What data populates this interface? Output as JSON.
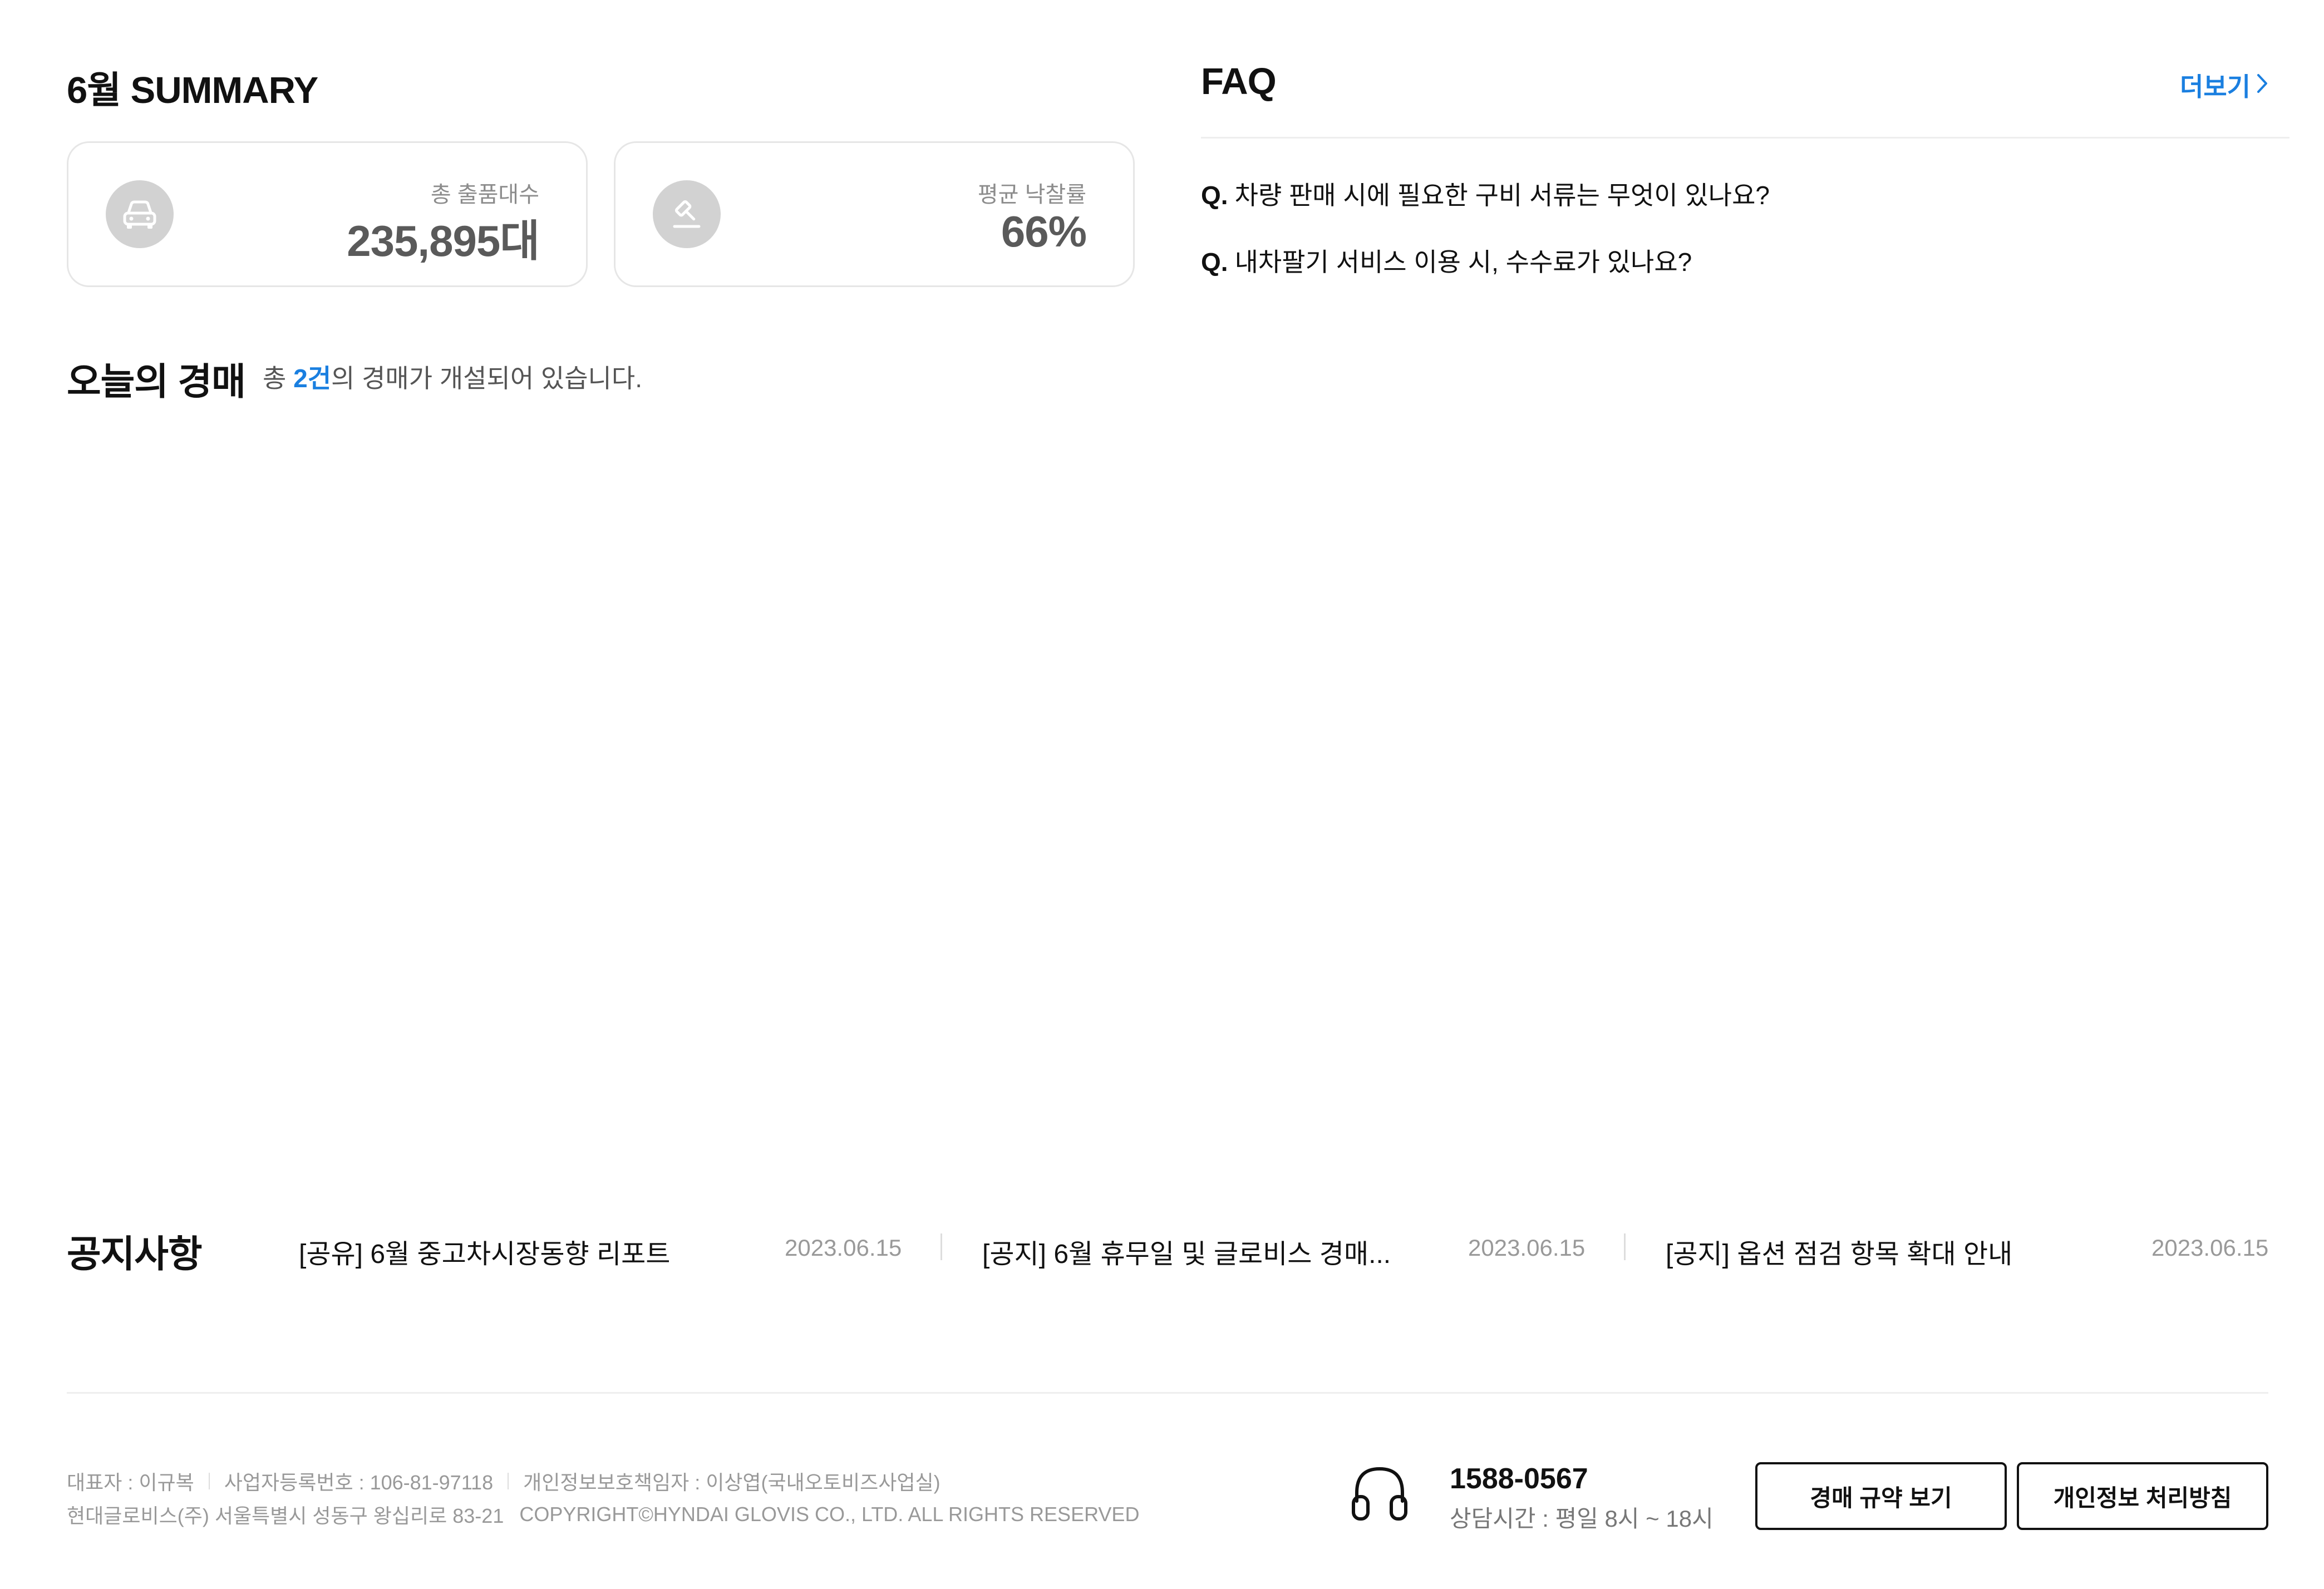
{
  "summary": {
    "title": "6월 SUMMARY",
    "cards": [
      {
        "icon": "car-icon",
        "label": "총 출품대수",
        "value": "235,895대"
      },
      {
        "icon": "auction-hammer-icon",
        "label": "평균 낙찰률",
        "value": "66%"
      }
    ]
  },
  "faq": {
    "title": "FAQ",
    "more_label": "더보기",
    "items": [
      {
        "q": "Q.",
        "text": "차량 판매 시에 필요한 구비 서류는 무엇이 있나요?"
      },
      {
        "q": "Q.",
        "text": "내차팔기 서비스 이용 시, 수수료가 있나요?"
      }
    ]
  },
  "today": {
    "title": "오늘의 경매",
    "prefix": "총 ",
    "count": "2건",
    "suffix": "의 경매가 개설되어 있습니다."
  },
  "notice": {
    "title": "공지사항",
    "items": [
      {
        "text": "[공유] 6월 중고차시장동향 리포트",
        "date": "2023.06.15"
      },
      {
        "text": "[공지] 6월 휴무일 및 글로비스 경매...",
        "date": "2023.06.15"
      },
      {
        "text": "[공지] 옵션 점검 항목 확대 안내",
        "date": "2023.06.15"
      }
    ]
  },
  "footer": {
    "ceo": "대표자 : 이규복",
    "biz_no": "사업자등록번호 : 106-81-97118",
    "privacy_officer": "개인정보보호책임자 : 이상엽(국내오토비즈사업실)",
    "address": "현대글로비스(주) 서울특별시 성동구 왕십리로 83-21",
    "copyright": "COPYRIGHT©HYNDAI GLOVIS CO., LTD. ALL RIGHTS RESERVED",
    "phone": "1588-0567",
    "hours": "상담시간 : 평일 8시 ~ 18시",
    "buttons": {
      "terms": "경매 규약 보기",
      "privacy": "개인정보 처리방침"
    }
  },
  "colors": {
    "accent": "#1a7fe0",
    "icon_bg": "#d2d2d2",
    "muted": "#999999"
  }
}
